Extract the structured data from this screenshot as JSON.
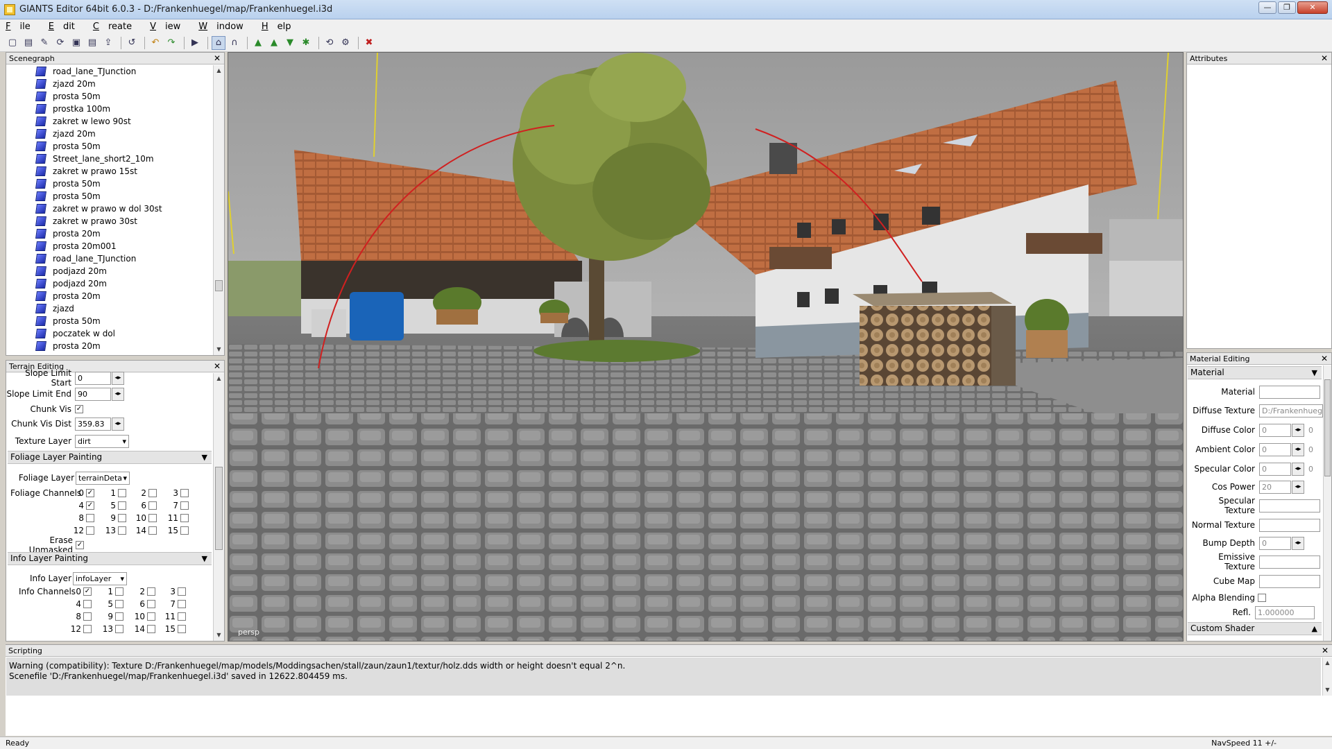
{
  "window": {
    "title": "GIANTS Editor 64bit 6.0.3 - D:/Frankenhuegel/map/Frankenhuegel.i3d",
    "controls": [
      "—",
      "❐",
      "✕"
    ]
  },
  "menu": [
    {
      "label": "File",
      "key": "F",
      "rest": "ile"
    },
    {
      "label": "Edit",
      "key": "E",
      "rest": "dit"
    },
    {
      "label": "Create",
      "key": "C",
      "rest": "reate"
    },
    {
      "label": "View",
      "key": "V",
      "rest": "iew"
    },
    {
      "label": "Window",
      "key": "W",
      "rest": "indow"
    },
    {
      "label": "Help",
      "key": "H",
      "rest": "elp"
    }
  ],
  "toolbar": {
    "icons": [
      "new-icon",
      "open-icon",
      "edit-icon",
      "reload-icon",
      "save-icon",
      "save-as-icon",
      "import-icon",
      "undo-history-icon",
      "undo-icon",
      "redo-icon",
      "play-icon",
      "select-mode-icon",
      "move-mode-icon",
      "terrain-icon",
      "terrain-up-icon",
      "terrain-down-icon",
      "terrain-paint-icon",
      "refresh-icon",
      "settings-icon",
      "delete-icon"
    ],
    "glyphs": [
      "▢",
      "▤",
      "✎",
      "⟳",
      "▣",
      "▤",
      "⇪",
      "↺",
      "↶",
      "↷",
      "▶",
      "⌂",
      "∩",
      "▲",
      "▲",
      "▼",
      "✱",
      "⟲",
      "⚙",
      "✖"
    ]
  },
  "scenegraph": {
    "title": "Scenegraph",
    "close": "✕",
    "items": [
      "road_lane_TJunction",
      "zjazd 20m",
      "prosta 50m",
      "prostka 100m",
      "zakret w lewo 90st",
      "zjazd 20m",
      "prosta 50m",
      "Street_lane_short2_10m",
      "zakret w prawo 15st",
      "prosta 50m",
      "prosta 50m",
      "zakret w prawo w dol 30st",
      "zakret w prawo 30st",
      "prosta 20m",
      "prosta 20m001",
      "road_lane_TJunction",
      "podjazd 20m",
      "podjazd 20m",
      "prosta 20m",
      "zjazd",
      "prosta 50m",
      "poczatek w  dol",
      "prosta 20m"
    ],
    "scroll_up": "▲",
    "scroll_down": "▼"
  },
  "terrain": {
    "title": "Terrain Editing",
    "close": "✕",
    "slope_start_label": "Slope Limit Start",
    "slope_start_value": "0",
    "slope_end_label": "Slope Limit End",
    "slope_end_value": "90",
    "chunk_vis_label": "Chunk Vis",
    "chunk_vis_checked": "✓",
    "chunk_vis_dist_label": "Chunk Vis Dist",
    "chunk_vis_dist_value": "359.83",
    "texture_layer_label": "Texture Layer",
    "texture_layer_value": "dirt",
    "spin": "◂▸",
    "foliage_section": "Foliage Layer Painting",
    "foliage_layer_label": "Foliage Layer",
    "foliage_layer_value": "terrainDeta",
    "foliage_channels_label": "Foliage Channels",
    "foliage_channels": [
      {
        "n": "0",
        "c": "✓"
      },
      {
        "n": "1",
        "c": ""
      },
      {
        "n": "2",
        "c": ""
      },
      {
        "n": "3",
        "c": ""
      },
      {
        "n": "4",
        "c": "✓"
      },
      {
        "n": "5",
        "c": ""
      },
      {
        "n": "6",
        "c": ""
      },
      {
        "n": "7",
        "c": ""
      },
      {
        "n": "8",
        "c": ""
      },
      {
        "n": "9",
        "c": ""
      },
      {
        "n": "10",
        "c": ""
      },
      {
        "n": "11",
        "c": ""
      },
      {
        "n": "12",
        "c": ""
      },
      {
        "n": "13",
        "c": ""
      },
      {
        "n": "14",
        "c": ""
      },
      {
        "n": "15",
        "c": ""
      }
    ],
    "erase_unmasked_label": "Erase Unmasked",
    "erase_unmasked_checked": "✓",
    "info_section": "Info Layer Painting",
    "info_layer_label": "Info Layer",
    "info_layer_value": "infoLayer",
    "info_channels_label": "Info Channels",
    "info_channels": [
      {
        "n": "0",
        "c": "✓"
      },
      {
        "n": "1",
        "c": ""
      },
      {
        "n": "2",
        "c": ""
      },
      {
        "n": "3",
        "c": ""
      },
      {
        "n": "4",
        "c": ""
      },
      {
        "n": "5",
        "c": ""
      },
      {
        "n": "6",
        "c": ""
      },
      {
        "n": "7",
        "c": ""
      },
      {
        "n": "8",
        "c": ""
      },
      {
        "n": "9",
        "c": ""
      },
      {
        "n": "10",
        "c": ""
      },
      {
        "n": "11",
        "c": ""
      },
      {
        "n": "12",
        "c": ""
      },
      {
        "n": "13",
        "c": ""
      },
      {
        "n": "14",
        "c": ""
      },
      {
        "n": "15",
        "c": ""
      }
    ],
    "section_toggle": "▼"
  },
  "viewport": {
    "camera_label": "persp"
  },
  "attributes": {
    "title": "Attributes",
    "close": "✕"
  },
  "material_editing": {
    "title": "Material Editing",
    "close": "✕",
    "section": "Material",
    "section_toggle": "▼",
    "material_label": "Material",
    "material_value": "",
    "diffuse_texture_label": "Diffuse Texture",
    "diffuse_texture_value": "D:/Frankenhueg",
    "diffuse_color_label": "Diffuse Color",
    "diffuse_color_value": "0",
    "diffuse_color_value2": "0",
    "ambient_color_label": "Ambient Color",
    "ambient_color_value": "0",
    "ambient_color_value2": "0",
    "specular_color_label": "Specular Color",
    "specular_color_value": "0",
    "specular_color_value2": "0",
    "cos_power_label": "Cos Power",
    "cos_power_value": "20",
    "specular_texture_label": "Specular Texture",
    "normal_texture_label": "Normal Texture",
    "bump_depth_label": "Bump Depth",
    "bump_depth_value": "0",
    "emissive_texture_label": "Emissive Texture",
    "cube_map_label": "Cube Map",
    "alpha_blending_label": "Alpha Blending",
    "refl_label": "Refl.",
    "refl_value": "1.000000",
    "custom_shader_section": "Custom Shader",
    "custom_shader_toggle": "▲",
    "spin": "◂▸"
  },
  "scripting": {
    "title": "Scripting",
    "close": "✕",
    "log": [
      "Warning (compatibility): Texture D:/Frankenhuegel/map/models/Moddingsachen/stall/zaun/zaun1/textur/holz.dds width or height doesn't equal 2^n.",
      "Scenefile 'D:/Frankenhuegel/map/Frankenhuegel.i3d' saved in 12622.804459 ms."
    ]
  },
  "status": {
    "text": "Ready",
    "nav_speed": "NavSpeed 11 +/-"
  }
}
